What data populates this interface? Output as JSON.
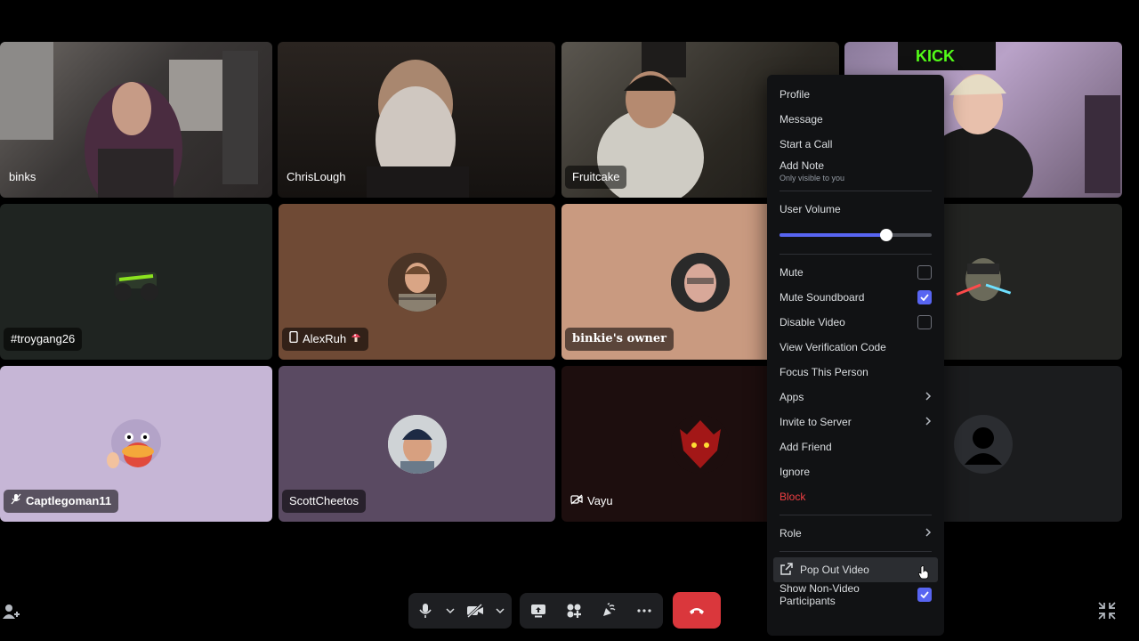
{
  "participants": [
    {
      "name": "binks"
    },
    {
      "name": "ChrisLough"
    },
    {
      "name": "Fruitcake"
    },
    {
      "name": "#troygang26"
    },
    {
      "name": "AlexRuh"
    },
    {
      "name": "binkie's owner"
    },
    {
      "name": "Captlegoman11"
    },
    {
      "name": "ScottCheetos"
    },
    {
      "name": "Vayu"
    }
  ],
  "menu": {
    "profile": "Profile",
    "message": "Message",
    "start_call": "Start a Call",
    "add_note": "Add Note",
    "add_note_sub": "Only visible to you",
    "user_volume": "User Volume",
    "volume_level": 0.7,
    "mute": "Mute",
    "mute_checked": false,
    "mute_soundboard": "Mute Soundboard",
    "mute_soundboard_checked": true,
    "disable_video": "Disable Video",
    "disable_video_checked": false,
    "view_verification": "View Verification Code",
    "focus_person": "Focus This Person",
    "apps": "Apps",
    "invite_to_server": "Invite to Server",
    "add_friend": "Add Friend",
    "ignore": "Ignore",
    "block": "Block",
    "role": "Role",
    "pop_out_video": "Pop Out Video",
    "show_non_video": "Show Non-Video Participants",
    "show_non_video_checked": true
  },
  "colors": {
    "accent": "#5865f2",
    "danger": "#f23f43",
    "hangup": "#da373c",
    "menu_bg": "#111214"
  }
}
